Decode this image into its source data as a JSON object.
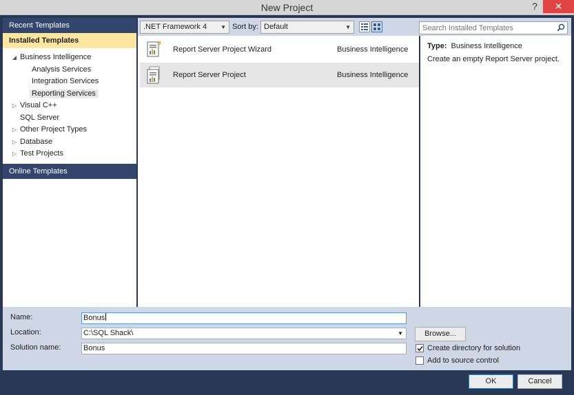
{
  "window": {
    "title": "New Project",
    "help_glyph": "?",
    "close_glyph": "✕"
  },
  "left_panel": {
    "recent_templates": "Recent Templates",
    "installed_templates": "Installed Templates",
    "tree": [
      {
        "label": "Business Intelligence",
        "expanded": true,
        "indent": 0
      },
      {
        "label": "Analysis Services",
        "indent": 1
      },
      {
        "label": "Integration Services",
        "indent": 1
      },
      {
        "label": "Reporting Services",
        "indent": 1,
        "selected": true
      },
      {
        "label": "Visual C++",
        "expanded": false,
        "indent": 0
      },
      {
        "label": "SQL Server",
        "indent": 0
      },
      {
        "label": "Other Project Types",
        "expanded": false,
        "indent": 0
      },
      {
        "label": "Database",
        "expanded": false,
        "indent": 0
      },
      {
        "label": "Test Projects",
        "expanded": false,
        "indent": 0
      }
    ],
    "online_templates": "Online Templates"
  },
  "toolbar": {
    "framework": ".NET Framework 4",
    "sort_by_label": "Sort by:",
    "sort_value": "Default",
    "search_placeholder": "Search Installed Templates"
  },
  "templates": [
    {
      "name": "Report Server Project Wizard",
      "category": "Business Intelligence",
      "selected": false
    },
    {
      "name": "Report Server Project",
      "category": "Business Intelligence",
      "selected": true
    }
  ],
  "description": {
    "type_label": "Type:",
    "type_value": "Business Intelligence",
    "text": "Create an empty Report Server project."
  },
  "form": {
    "name_label": "Name:",
    "name_value": "Bonus",
    "location_label": "Location:",
    "location_value": "C:\\SQL Shack\\",
    "solution_label": "Solution name:",
    "solution_value": "Bonus",
    "browse_label": "Browse...",
    "create_dir_label": "Create directory for solution",
    "create_dir_checked": true,
    "source_control_label": "Add to source control",
    "source_control_checked": false
  },
  "buttons": {
    "ok": "OK",
    "cancel": "Cancel"
  },
  "colors": {
    "frame": "#293955",
    "header_selected": "#fde6a0",
    "close": "#e04343",
    "panel_band": "#cfd6e5"
  }
}
